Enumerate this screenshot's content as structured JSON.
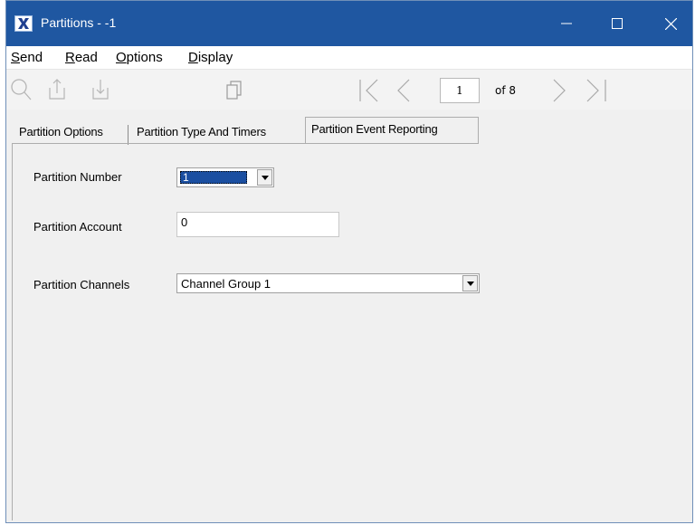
{
  "window": {
    "title": "Partitions - -1",
    "icon": "app-x-icon",
    "accent": "#1f57a1"
  },
  "menu": {
    "items": [
      {
        "label": "Send",
        "mnemonic": "S",
        "rest": "end"
      },
      {
        "label": "Read",
        "mnemonic": "R",
        "rest": "ead"
      },
      {
        "label": "Options",
        "mnemonic": "O",
        "rest": "ptions"
      },
      {
        "label": "Display",
        "mnemonic": "D",
        "rest": "isplay"
      }
    ]
  },
  "toolbar": {
    "icons": [
      "search-icon",
      "upload-icon",
      "download-icon",
      "copy-icon"
    ],
    "nav": [
      "first-page-icon",
      "previous-page-icon",
      "next-page-icon",
      "last-page-icon"
    ],
    "page_value": "1",
    "page_total": "of 8"
  },
  "tabs": [
    {
      "label": "Partition Options",
      "active": false
    },
    {
      "label": "Partition Type And Timers",
      "active": false
    },
    {
      "label": "Partition Event Reporting",
      "active": true
    }
  ],
  "form": {
    "partition_number": {
      "label": "Partition Number",
      "value": "1"
    },
    "partition_account": {
      "label": "Partition Account",
      "value": "0"
    },
    "partition_channels": {
      "label": "Partition Channels",
      "value": "Channel Group 1"
    }
  }
}
